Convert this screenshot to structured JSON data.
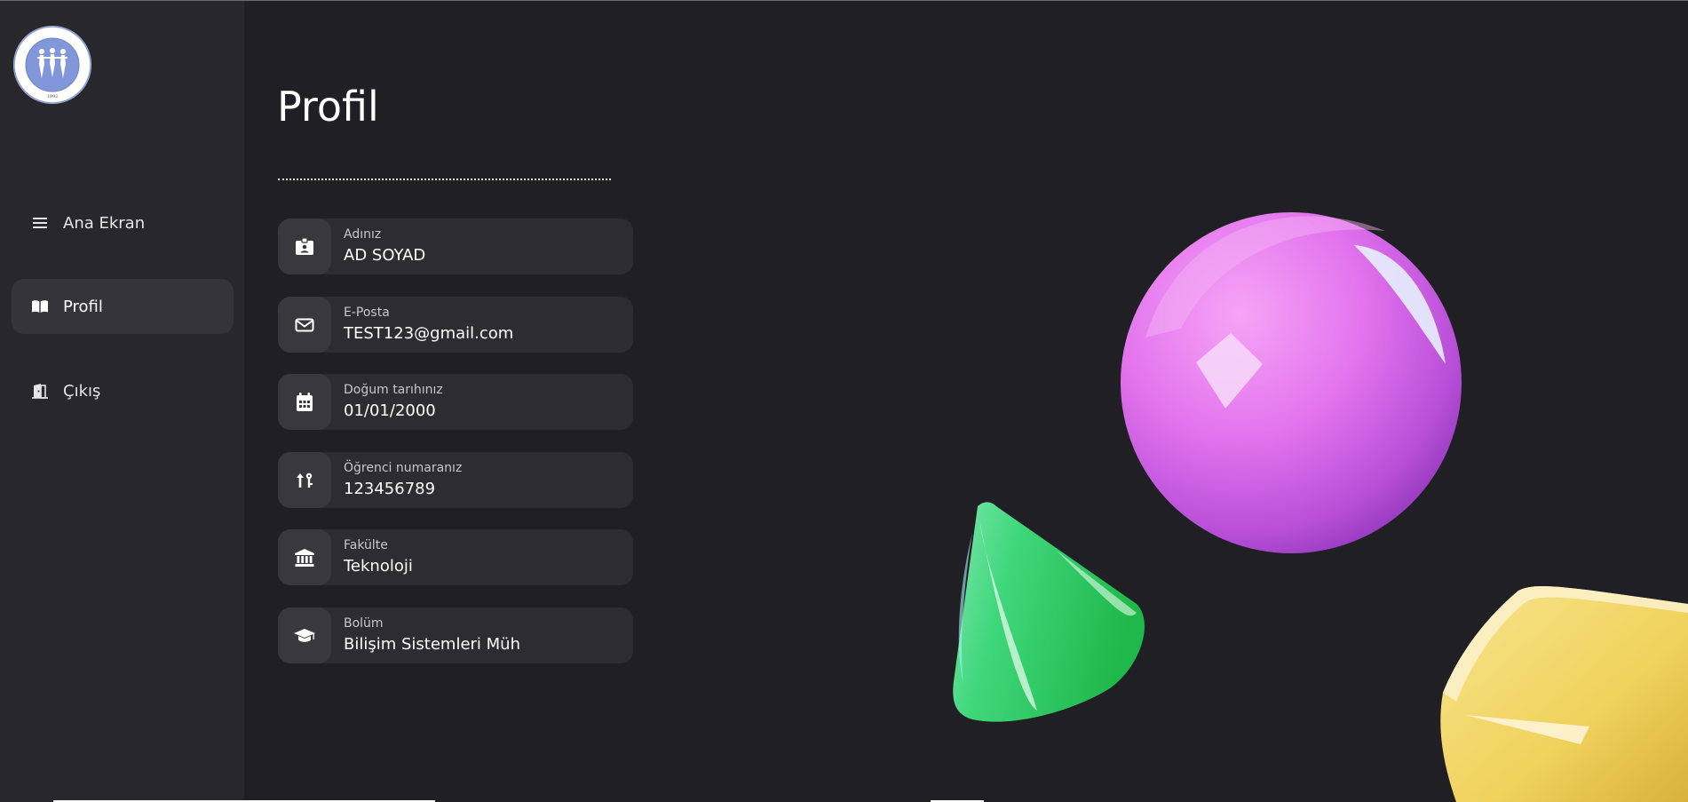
{
  "sidebar": {
    "logo": {
      "text": "KOCAELİ ÜNİVERSİTESİ",
      "year": "1992"
    },
    "items": [
      {
        "label": "Ana Ekran",
        "icon": "menu-icon"
      },
      {
        "label": "Profil",
        "icon": "book-icon",
        "active": true
      },
      {
        "label": "Çıkış",
        "icon": "door-icon"
      }
    ]
  },
  "main": {
    "title": "Profil",
    "fields": [
      {
        "label": "Adınız",
        "value": "AD SOYAD",
        "icon": "id-card-icon"
      },
      {
        "label": "E-Posta",
        "value": "TEST123@gmail.com",
        "icon": "envelope-icon"
      },
      {
        "label": "Doğum tarıhınız",
        "value": "01/01/2000",
        "icon": "calendar-icon"
      },
      {
        "label": "Öğrenci numaranız",
        "value": "123456789",
        "icon": "student-number-icon"
      },
      {
        "label": "Fakülte",
        "value": "Teknoloji",
        "icon": "building-icon"
      },
      {
        "label": "Bolüm",
        "value": "Bilişim Sistemleri Müh",
        "icon": "graduation-cap-icon"
      }
    ]
  },
  "colors": {
    "background": "#202024",
    "sidebar": "#28282c",
    "active_item": "#353539",
    "field_bg": "#2d2d31",
    "sphere": "#d070ec",
    "cone": "#3ad06a",
    "cube": "#f2d35c",
    "logo_blue": "#8197d9"
  }
}
